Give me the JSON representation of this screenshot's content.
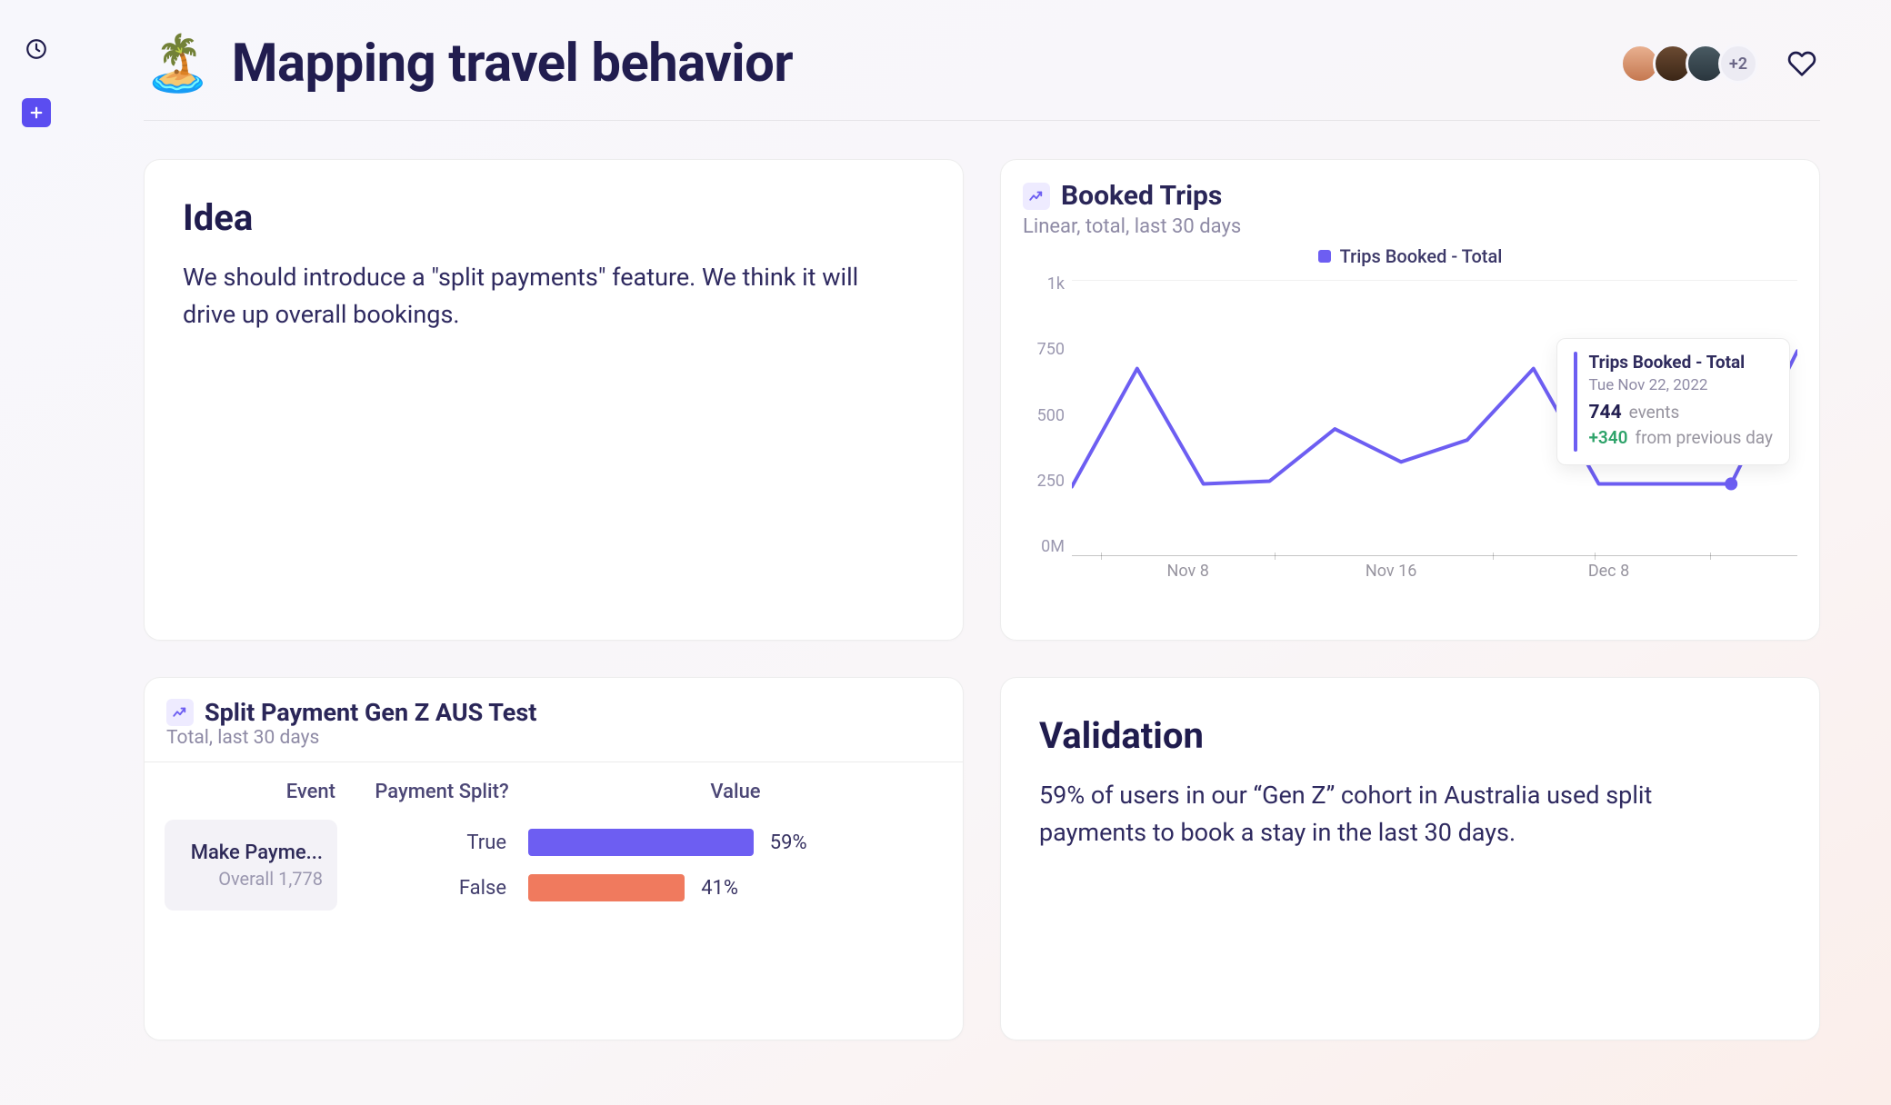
{
  "header": {
    "emoji": "🏝️",
    "title": "Mapping travel behavior",
    "avatar_overflow": "+2"
  },
  "idea": {
    "heading": "Idea",
    "body": "We should introduce a \"split payments\" feature. We think it will drive up overall bookings."
  },
  "booked": {
    "title": "Booked Trips",
    "subtitle": "Linear, total, last 30 days",
    "legend": "Trips Booked - Total",
    "y_ticks": [
      "1k",
      "750",
      "500",
      "250",
      "0M"
    ],
    "x_ticks": [
      "Nov 8",
      "Nov 16",
      "Dec 8"
    ],
    "tooltip": {
      "title": "Trips Booked - Total",
      "date": "Tue Nov 22, 2022",
      "value": "744",
      "value_label": "events",
      "delta": "+340",
      "delta_label": "from previous day"
    }
  },
  "split": {
    "title": "Split Payment Gen Z AUS Test",
    "subtitle": "Total, last 30 days",
    "columns": [
      "Event",
      "Payment Split?",
      "Value"
    ],
    "event_name": "Make Payme...",
    "event_overall_label": "Overall 1,778",
    "rows": [
      {
        "label": "True",
        "pct_text": "59%",
        "pct": 59,
        "color": "true"
      },
      {
        "label": "False",
        "pct_text": "41%",
        "pct": 41,
        "color": "false"
      }
    ]
  },
  "validation": {
    "heading": "Validation",
    "body": "59% of users in our “Gen Z” cohort in Australia used split payments to book a stay in the last 30 days."
  },
  "chart_data": [
    {
      "type": "line",
      "title": "Booked Trips",
      "subtitle": "Linear, total, last 30 days",
      "legend": [
        "Trips Booked - Total"
      ],
      "ylabel": "",
      "xlabel": "",
      "ylim": [
        0,
        1000
      ],
      "y_ticks": [
        0,
        250,
        500,
        750,
        1000
      ],
      "x_ticks": [
        "Nov 8",
        "Nov 16",
        "Dec 8"
      ],
      "series": [
        {
          "name": "Trips Booked - Total",
          "x_index": [
            0,
            1,
            2,
            3,
            4,
            5,
            6,
            7,
            8,
            9,
            10,
            11
          ],
          "values": [
            250,
            680,
            260,
            270,
            460,
            340,
            420,
            680,
            260,
            260,
            260,
            744
          ]
        }
      ],
      "highlight": {
        "date": "Tue Nov 22, 2022",
        "value": 744,
        "delta": 340
      }
    },
    {
      "type": "bar",
      "title": "Split Payment Gen Z AUS Test",
      "subtitle": "Total, last 30 days",
      "orientation": "horizontal",
      "event": "Make Payment",
      "overall": 1778,
      "categories": [
        "True",
        "False"
      ],
      "values": [
        59,
        41
      ],
      "unit": "%"
    }
  ]
}
